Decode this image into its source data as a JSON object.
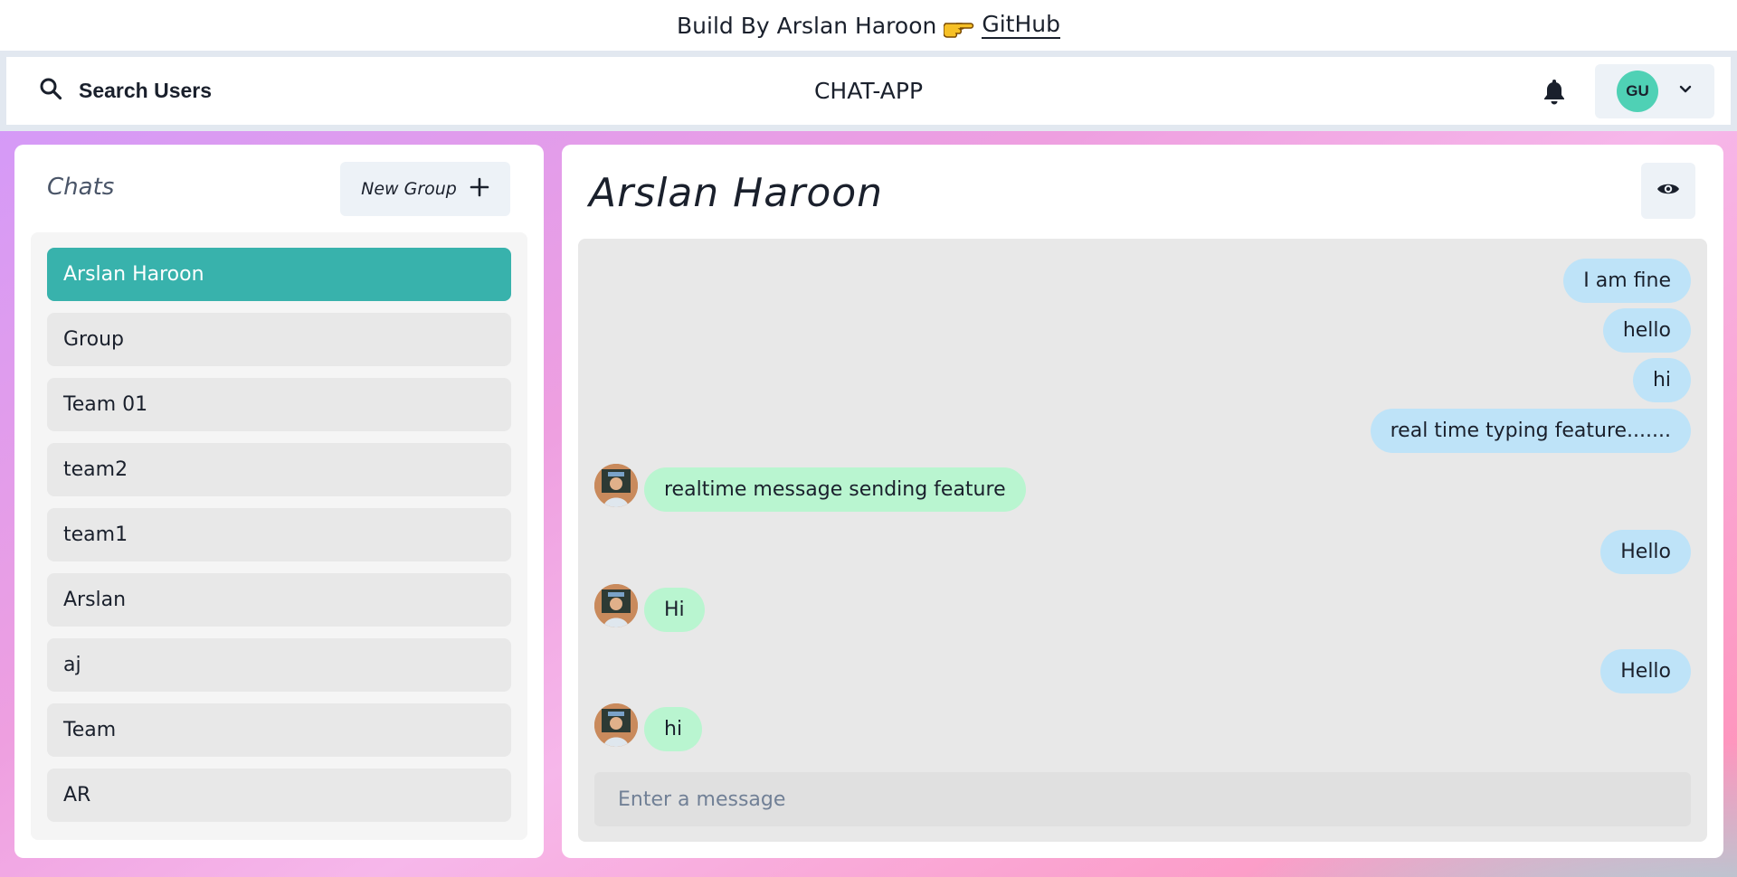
{
  "credit": {
    "text": "Build By Arslan Haroon",
    "icon": "pointing-hand-icon",
    "link_label": "GitHub"
  },
  "header": {
    "search_label": "Search Users",
    "search_icon": "search-icon",
    "app_title": "CHAT-APP",
    "notification_icon": "bell-icon",
    "profile_initials": "GU",
    "dropdown_icon": "chevron-down-icon"
  },
  "sidebar": {
    "title": "Chats",
    "new_group_label": "New Group",
    "chats": [
      {
        "label": "Arslan Haroon",
        "active": true
      },
      {
        "label": "Group",
        "active": false
      },
      {
        "label": "Team 01",
        "active": false
      },
      {
        "label": "team2",
        "active": false
      },
      {
        "label": "team1",
        "active": false
      },
      {
        "label": "Arslan",
        "active": false
      },
      {
        "label": "aj",
        "active": false
      },
      {
        "label": "Team",
        "active": false
      },
      {
        "label": "AR",
        "active": false
      }
    ]
  },
  "conversation": {
    "title": "Arslan Haroon",
    "view_icon": "eye-icon",
    "messages": [
      {
        "text": "I am fine",
        "direction": "out"
      },
      {
        "text": "hello",
        "direction": "out"
      },
      {
        "text": "hi",
        "direction": "out"
      },
      {
        "text": "real time typing feature.......",
        "direction": "out"
      },
      {
        "text": "realtime message sending feature",
        "direction": "in"
      },
      {
        "text": "Hello",
        "direction": "out"
      },
      {
        "text": "Hi",
        "direction": "in"
      },
      {
        "text": "Hello",
        "direction": "out"
      },
      {
        "text": "hi",
        "direction": "in"
      }
    ],
    "input_placeholder": "Enter a message"
  },
  "colors": {
    "active_chat": "#38b2ac",
    "outgoing_bubble": "#bee3f8",
    "incoming_bubble": "#b9f5d0",
    "avatar_bg": "#4fd1b5"
  }
}
